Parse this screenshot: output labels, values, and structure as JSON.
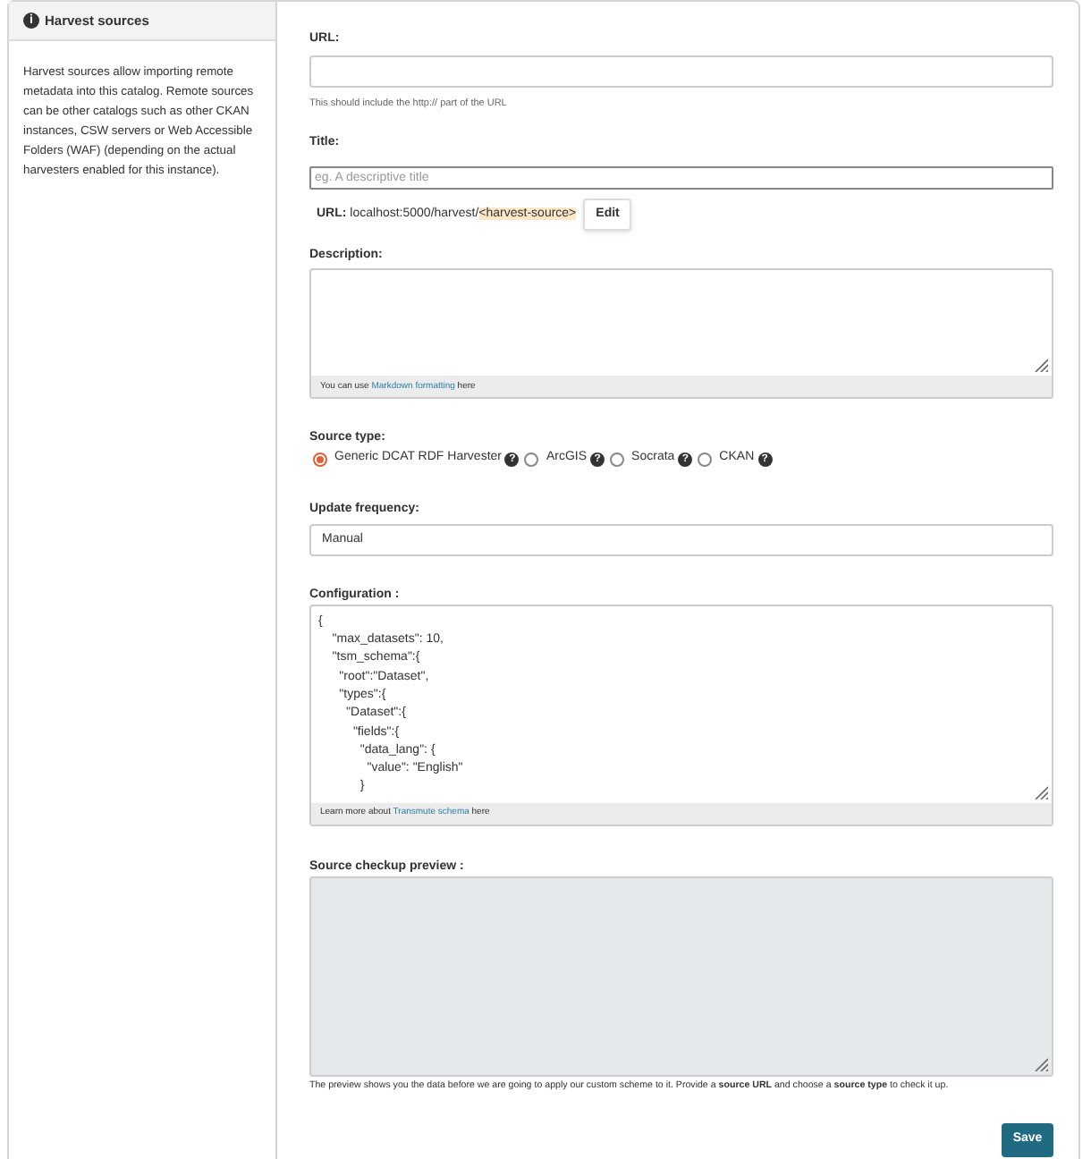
{
  "sidebar": {
    "title": "Harvest sources",
    "info_icon": "i",
    "text": "Harvest sources allow importing remote metadata into this catalog. Remote sources can be other catalogs such as other CKAN instances, CSW servers or Web Accessible Folders (WAF) (depending on the actual harvesters enabled for this instance)."
  },
  "url_field": {
    "label": "URL:",
    "help": "This should include the http:// part of the URL"
  },
  "title_field": {
    "label": "Title:",
    "placeholder": "eg. A descriptive title"
  },
  "slug": {
    "label": "URL:",
    "prefix": "localhost:5000/harvest/",
    "slug": "<harvest-source>",
    "button": "Edit"
  },
  "description": {
    "label": "Description:",
    "footer_before": "You can use ",
    "footer_link": "Markdown formatting",
    "footer_after": " here"
  },
  "source_type": {
    "label": "Source type:",
    "help_icon": "?",
    "options": [
      {
        "label": "Generic DCAT RDF Harvester",
        "selected": true
      },
      {
        "label": "ArcGIS",
        "selected": false
      },
      {
        "label": "Socrata",
        "selected": false
      },
      {
        "label": "CKAN",
        "selected": false
      }
    ]
  },
  "update_frequency": {
    "label": "Update frequency:",
    "value": "Manual"
  },
  "configuration": {
    "label": "Configuration :",
    "value": "{\n    \"max_datasets\": 10,\n    \"tsm_schema\":{\n      \"root\":\"Dataset\",\n      \"types\":{\n        \"Dataset\":{\n          \"fields\":{\n            \"data_lang\": {\n              \"value\": \"English\"\n            }",
    "footer_before": "Learn more about ",
    "footer_link": "Transmute schema",
    "footer_after": " here"
  },
  "preview": {
    "label": "Source checkup preview :",
    "note": "The preview shows you the data before we are going to apply our custom scheme to it. Provide a **source URL** and choose a **source type** to check it up."
  },
  "save_button": "Save"
}
